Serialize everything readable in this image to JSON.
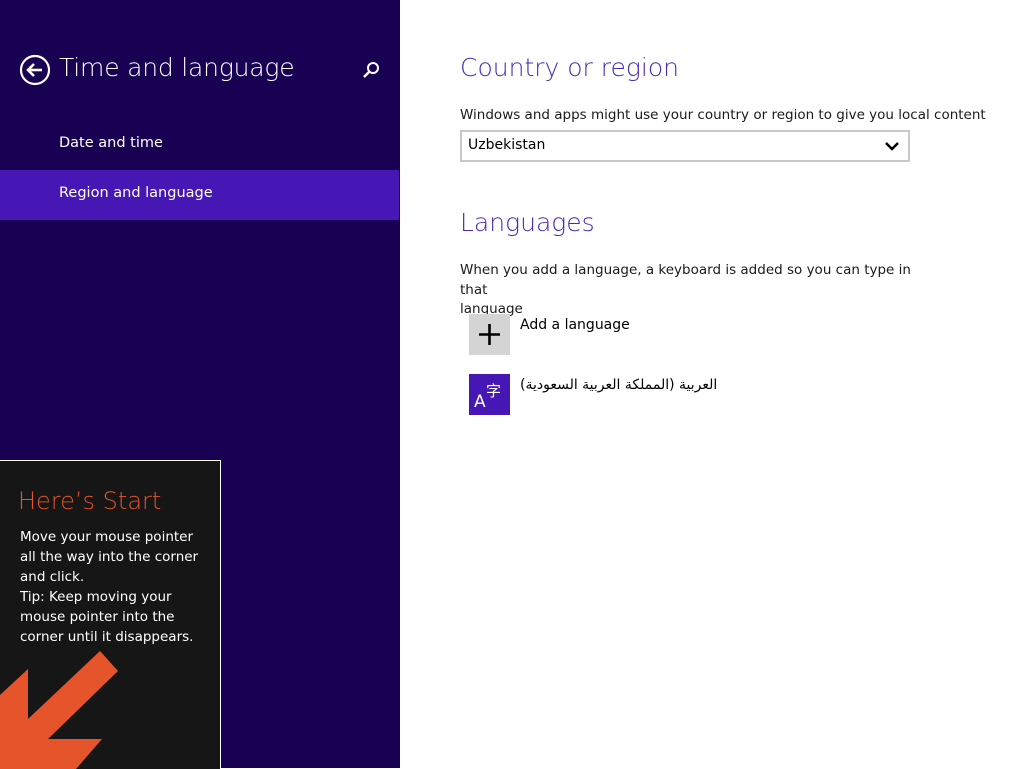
{
  "sidebar": {
    "title": "Time and language",
    "items": [
      {
        "label": "Date and time",
        "selected": false
      },
      {
        "label": "Region and language",
        "selected": true
      }
    ]
  },
  "start_tip": {
    "title": "Here’s Start",
    "lines": [
      "Move your mouse pointer",
      "all the way into the corner",
      "and click.",
      "Tip: Keep moving your",
      "mouse pointer into the",
      "corner until it disappears."
    ]
  },
  "country_section": {
    "heading": "Country or region",
    "description": "Windows and apps might use your country or region to give you local content",
    "selected_country": "Uzbekistan"
  },
  "languages_section": {
    "heading": "Languages",
    "description_line1": "When you add a language, a keyboard is added so you can type in that",
    "description_line2": "language",
    "add_label": "Add a language",
    "languages": [
      {
        "label": "العربية (المملكة العربية السعودية)"
      }
    ]
  },
  "colors": {
    "sidebar_bg": "#180052",
    "selected_item": "#4617b4",
    "heading": "#4b2ab3",
    "tip_accent": "#e5542a"
  },
  "icons": {
    "back": "back-arrow-circle-icon",
    "search": "magnifier-icon",
    "dropdown": "chevron-down-icon",
    "add": "plus-icon",
    "language": "language-a-character-icon",
    "tip_arrow": "arrow-down-left-icon"
  }
}
